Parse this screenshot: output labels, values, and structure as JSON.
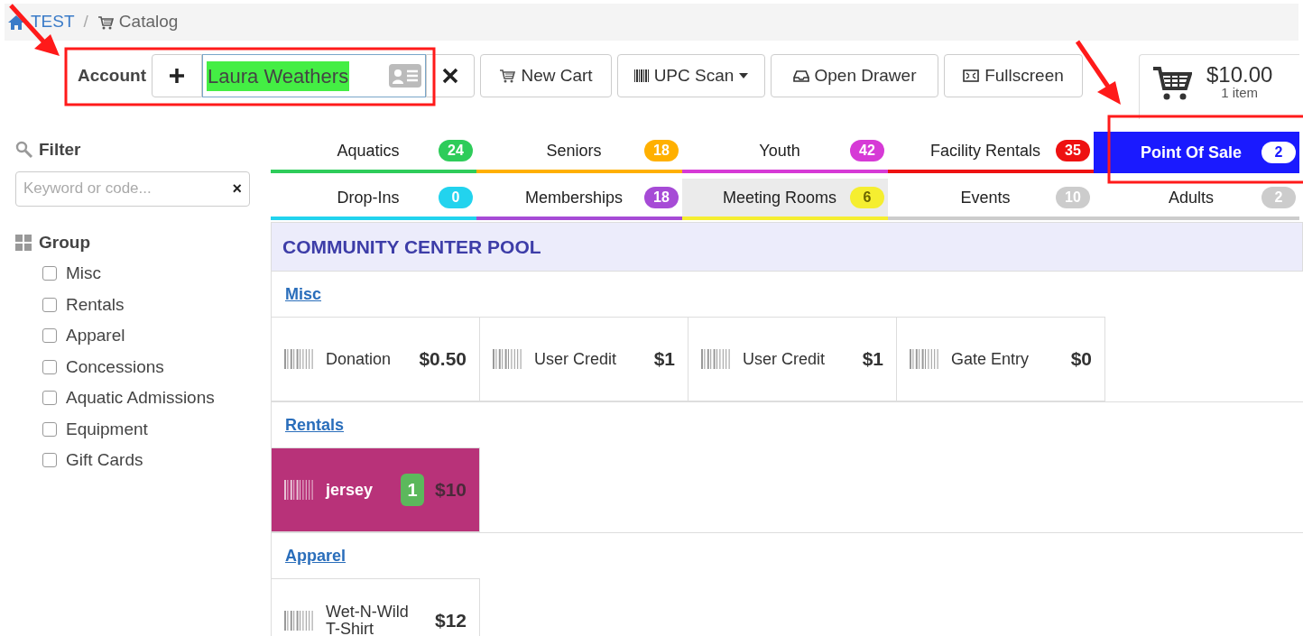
{
  "breadcrumb": [
    {
      "label": "TEST",
      "kind": "home"
    },
    {
      "label": "Catalog",
      "kind": "cart",
      "separator": "/"
    }
  ],
  "account": {
    "label": "Account",
    "value": "Laura Weathers",
    "highlight": true
  },
  "toolbar_buttons": [
    {
      "label": "New Cart",
      "kind": "cart"
    },
    {
      "label": "UPC Scan",
      "kind": "barcode",
      "dropdown": true
    },
    {
      "label": "Open Drawer",
      "kind": "drawer"
    },
    {
      "label": "Fullscreen",
      "kind": "fullscreen"
    }
  ],
  "cart": {
    "total": "$10.00",
    "items": "1 item"
  },
  "filter": {
    "title": "Filter",
    "placeholder": "Keyword or code...",
    "clear": "×"
  },
  "group": {
    "title": "Group",
    "items": [
      {
        "label": "Misc",
        "checked": false
      },
      {
        "label": "Rentals",
        "checked": false
      },
      {
        "label": "Apparel",
        "checked": false
      },
      {
        "label": "Concessions",
        "checked": false
      },
      {
        "label": "Aquatic Admissions",
        "checked": false
      },
      {
        "label": "Equipment",
        "checked": false
      },
      {
        "label": "Gift Cards",
        "checked": false
      }
    ]
  },
  "tabs": [
    [
      {
        "label": "Aquatics",
        "count": "24",
        "color": "#2ecc5a",
        "selected": false,
        "kind": "line"
      },
      {
        "label": "Seniors",
        "count": "18",
        "color": "#ffb000",
        "selected": false,
        "kind": "line"
      },
      {
        "label": "Youth",
        "count": "42",
        "color": "#d63ad6",
        "selected": false,
        "kind": "line"
      },
      {
        "label": "Facility Rentals",
        "count": "35",
        "color": "#ee1111",
        "selected": false,
        "kind": "line"
      },
      {
        "label": "Point Of Sale",
        "count": "2",
        "color": "#1a1aff",
        "selected": false,
        "kind": "solid"
      }
    ],
    [
      {
        "label": "Drop-Ins",
        "count": "0",
        "color": "#22d3ee",
        "selected": false,
        "kind": "line"
      },
      {
        "label": "Memberships",
        "count": "18",
        "color": "#a64bd6",
        "selected": false,
        "kind": "line"
      },
      {
        "label": "Meeting Rooms",
        "count": "6",
        "color": "#f5ee30",
        "selected": true,
        "kind": "line"
      },
      {
        "label": "Events",
        "count": "10",
        "color": "#cccccc",
        "selected": false,
        "kind": "line"
      },
      {
        "label": "Adults",
        "count": "2",
        "color": "#cccccc",
        "selected": false,
        "kind": "line"
      }
    ]
  ],
  "catalog": {
    "title": "COMMUNITY CENTER POOL",
    "sections": [
      {
        "title": "Misc",
        "items": [
          {
            "name": "Donation",
            "price": "$0.50",
            "in_cart": false
          },
          {
            "name": "User Credit",
            "price": "$1",
            "in_cart": false
          },
          {
            "name": "User Credit",
            "price": "$1",
            "in_cart": false
          },
          {
            "name": "Gate Entry",
            "price": "$0",
            "in_cart": false
          }
        ]
      },
      {
        "title": "Rentals",
        "items": [
          {
            "name": "jersey",
            "price": "$10",
            "in_cart": true,
            "count": "1"
          }
        ]
      },
      {
        "title": "Apparel",
        "items": [
          {
            "name": "Wet-N-Wild T-Shirt",
            "price": "$12",
            "in_cart": false
          }
        ]
      }
    ]
  }
}
